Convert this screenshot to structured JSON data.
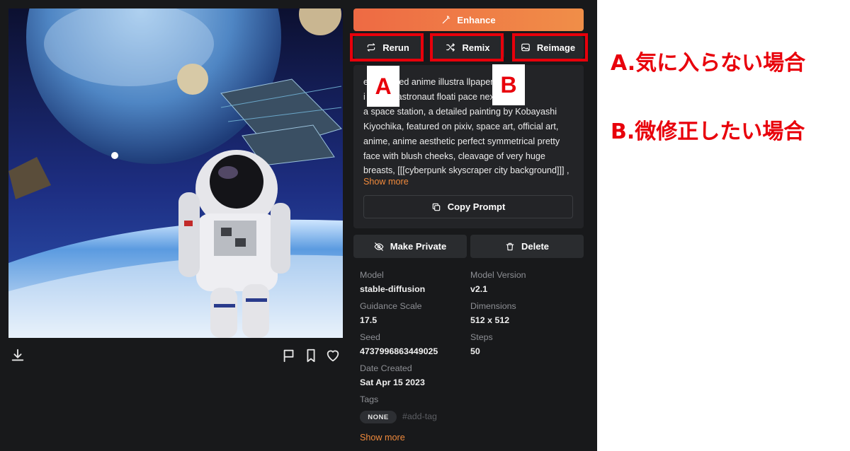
{
  "toolbar": {
    "enhance_label": "Enhance",
    "rerun_label": "Rerun",
    "remix_label": "Remix",
    "reimage_label": "Reimage"
  },
  "prompt": {
    "lines": [
      "e      y detailed anime illustra      llpaper of",
      "i          female astronaut floati        pace next to",
      "a space station, a detailed painting by Kobayashi",
      "Kiyochika, featured on pixiv, space art, official art,",
      "anime, anime aesthetic perfect symmetrical pretty",
      "face with blush cheeks, cleavage of very huge",
      "breasts, [[[cyberpunk skyscraper city background]]] ,"
    ],
    "show_more": "Show more",
    "copy_label": "Copy Prompt"
  },
  "actions": {
    "make_private": "Make Private",
    "delete": "Delete"
  },
  "meta": {
    "model_label": "Model",
    "model_value": "stable-diffusion",
    "version_label": "Model Version",
    "version_value": "v2.1",
    "guidance_label": "Guidance Scale",
    "guidance_value": "17.5",
    "dimensions_label": "Dimensions",
    "dimensions_value": "512 x 512",
    "seed_label": "Seed",
    "seed_value": "4737996863449025",
    "steps_label": "Steps",
    "steps_value": "50",
    "date_label": "Date Created",
    "date_value": "Sat Apr 15 2023",
    "tags_label": "Tags",
    "tag_badge": "NONE",
    "tag_placeholder": "#add-tag",
    "show_more": "Show more"
  },
  "annotations": {
    "box_a": "A",
    "box_b": "B",
    "line_a": "A.気に入らない場合",
    "line_b": "B.微修正したい場合"
  },
  "colors": {
    "accent_orange": "#f08a3c",
    "highlight_red": "#e8000b",
    "panel_bg": "#18191b"
  },
  "icons": [
    "download-icon",
    "flag-icon",
    "bookmark-icon",
    "heart-icon",
    "wand-icon",
    "repeat-icon",
    "shuffle-icon",
    "image-icon",
    "copy-icon",
    "eye-off-icon",
    "trash-icon"
  ]
}
